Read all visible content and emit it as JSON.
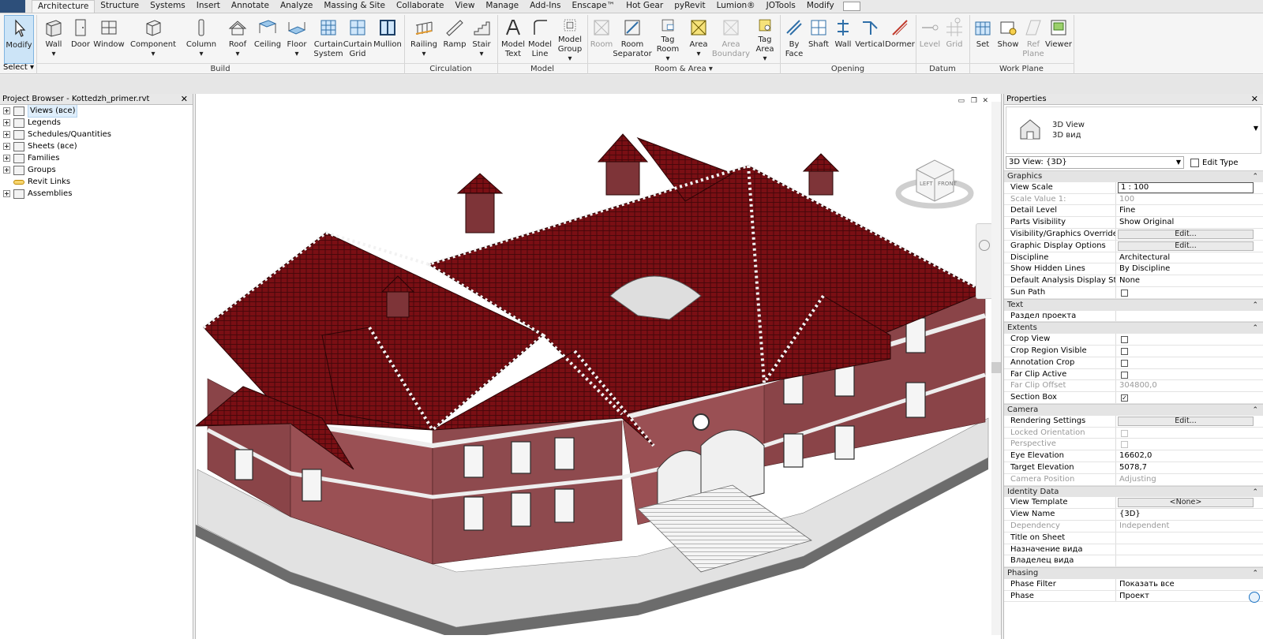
{
  "ribbon": {
    "tabs": [
      "Architecture",
      "Structure",
      "Systems",
      "Insert",
      "Annotate",
      "Analyze",
      "Massing & Site",
      "Collaborate",
      "View",
      "Manage",
      "Add-Ins",
      "Enscape™",
      "Hot Gear",
      "pyRevit",
      "Lumion®",
      "JOTools",
      "Modify"
    ],
    "active_tab": "Architecture",
    "select_label": "Select",
    "buttons": {
      "modify": "Modify",
      "wall": "Wall",
      "door": "Door",
      "window": "Window",
      "component": "Component",
      "column": "Column",
      "roof": "Roof",
      "ceiling": "Ceiling",
      "floor": "Floor",
      "curtain_system": "Curtain System",
      "curtain_grid": "Curtain Grid",
      "mullion": "Mullion",
      "railing": "Railing",
      "ramp": "Ramp",
      "stair": "Stair",
      "model_text": "Model Text",
      "model_line": "Model Line",
      "model_group": "Model Group",
      "room": "Room",
      "room_separator": "Room Separator",
      "tag_room": "Tag Room",
      "area": "Area",
      "area_boundary": "Area Boundary",
      "tag_area": "Tag Area",
      "by_face": "By Face",
      "shaft": "Shaft",
      "wall_opening": "Wall",
      "vertical": "Vertical",
      "dormer": "Dormer",
      "level": "Level",
      "grid": "Grid",
      "set": "Set",
      "show": "Show",
      "ref_plane": "Ref Plane",
      "viewer": "Viewer"
    },
    "groups": {
      "build": "Build",
      "circulation": "Circulation",
      "model": "Model",
      "room_area": "Room & Area ▾",
      "opening": "Opening",
      "datum": "Datum",
      "work_plane": "Work Plane"
    }
  },
  "browser": {
    "title": "Project Browser - Kottedzh_primer.rvt",
    "items": [
      "Views (все)",
      "Legends",
      "Schedules/Quantities",
      "Sheets (все)",
      "Families",
      "Groups",
      "Revit Links",
      "Assemblies"
    ]
  },
  "viewport": {
    "viewcube": {
      "left": "LEFT",
      "front": "FRONT"
    }
  },
  "properties": {
    "title": "Properties",
    "type_name_1": "3D View",
    "type_name_2": "3D вид",
    "view_selector": "3D View: {3D}",
    "edit_type": "Edit Type",
    "sections": [
      {
        "title": "Graphics",
        "rows": [
          {
            "name": "View Scale",
            "value": "1 : 100",
            "kind": "input"
          },
          {
            "name": "Scale Value    1:",
            "value": "100",
            "disabled": true
          },
          {
            "name": "Detail Level",
            "value": "Fine"
          },
          {
            "name": "Parts Visibility",
            "value": "Show Original"
          },
          {
            "name": "Visibility/Graphics Overrides",
            "value": "Edit...",
            "kind": "button"
          },
          {
            "name": "Graphic Display Options",
            "value": "Edit...",
            "kind": "button"
          },
          {
            "name": "Discipline",
            "value": "Architectural"
          },
          {
            "name": "Show Hidden Lines",
            "value": "By Discipline"
          },
          {
            "name": "Default Analysis Display Style",
            "value": "None"
          },
          {
            "name": "Sun Path",
            "value": "",
            "kind": "check",
            "checked": false
          }
        ]
      },
      {
        "title": "Text",
        "rows": [
          {
            "name": "Раздел проекта",
            "value": ""
          }
        ]
      },
      {
        "title": "Extents",
        "rows": [
          {
            "name": "Crop View",
            "value": "",
            "kind": "check",
            "checked": false
          },
          {
            "name": "Crop Region Visible",
            "value": "",
            "kind": "check",
            "checked": false
          },
          {
            "name": "Annotation Crop",
            "value": "",
            "kind": "check",
            "checked": false
          },
          {
            "name": "Far Clip Active",
            "value": "",
            "kind": "check",
            "checked": false
          },
          {
            "name": "Far Clip Offset",
            "value": "304800,0",
            "disabled": true
          },
          {
            "name": "Section Box",
            "value": "",
            "kind": "check",
            "checked": true
          }
        ]
      },
      {
        "title": "Camera",
        "rows": [
          {
            "name": "Rendering Settings",
            "value": "Edit...",
            "kind": "button"
          },
          {
            "name": "Locked Orientation",
            "value": "",
            "kind": "check",
            "checked": false,
            "disabled": true
          },
          {
            "name": "Perspective",
            "value": "",
            "kind": "check",
            "checked": false,
            "disabled": true
          },
          {
            "name": "Eye Elevation",
            "value": "16602,0"
          },
          {
            "name": "Target Elevation",
            "value": "5078,7"
          },
          {
            "name": "Camera Position",
            "value": "Adjusting",
            "disabled": true
          }
        ]
      },
      {
        "title": "Identity Data",
        "rows": [
          {
            "name": "View Template",
            "value": "<None>",
            "kind": "button"
          },
          {
            "name": "View Name",
            "value": "{3D}"
          },
          {
            "name": "Dependency",
            "value": "Independent",
            "disabled": true
          },
          {
            "name": "Title on Sheet",
            "value": ""
          },
          {
            "name": "Назначение вида",
            "value": ""
          },
          {
            "name": "Владелец вида",
            "value": ""
          }
        ]
      },
      {
        "title": "Phasing",
        "rows": [
          {
            "name": "Phase Filter",
            "value": "Показать все"
          },
          {
            "name": "Phase",
            "value": "Проект"
          }
        ]
      }
    ]
  },
  "colors": {
    "roof": "#7a0f14",
    "wall": "#8a4448",
    "trim": "#eaeaea",
    "selection": "#cce4f7"
  },
  "icons": [
    "modify-arrow-icon",
    "wall-icon",
    "door-icon",
    "window-icon",
    "component-icon",
    "roof-icon",
    "stair-icon",
    "area-icon",
    "viewer-icon",
    "house-3d-icon",
    "viewcube-icon",
    "steering-wheel-icon"
  ]
}
